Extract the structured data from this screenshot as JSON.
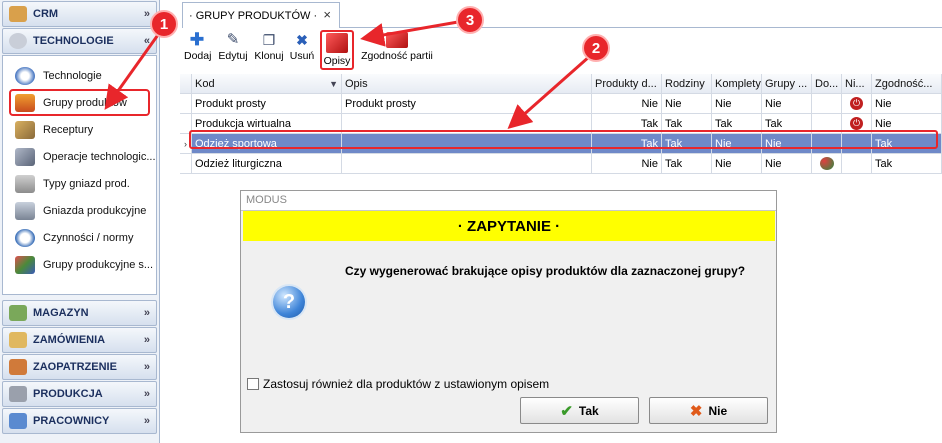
{
  "sidebar": {
    "groups_top": [
      {
        "label": "CRM"
      },
      {
        "label": "TECHNOLOGIE"
      }
    ],
    "items": [
      {
        "label": "Technologie"
      },
      {
        "label": "Grupy produktów"
      },
      {
        "label": "Receptury"
      },
      {
        "label": "Operacje technologic..."
      },
      {
        "label": "Typy gniazd prod."
      },
      {
        "label": "Gniazda produkcyjne"
      },
      {
        "label": "Czynności / normy"
      },
      {
        "label": "Grupy produkcyjne s..."
      }
    ],
    "groups_bottom": [
      {
        "label": "MAGAZYN"
      },
      {
        "label": "ZAMÓWIENIA"
      },
      {
        "label": "ZAOPATRZENIE"
      },
      {
        "label": "PRODUKCJA"
      },
      {
        "label": "PRACOWNICY"
      }
    ]
  },
  "tab": {
    "label": "· GRUPY PRODUKTÓW ·",
    "close": "×"
  },
  "toolbar": {
    "dodaj": "Dodaj",
    "edytuj": "Edytuj",
    "klonuj": "Klonuj",
    "usun": "Usuń",
    "opisy": "Opisy",
    "zgodnosc": "Zgodność partii"
  },
  "grid": {
    "columns": [
      "Kod",
      "Opis",
      "Produkty d...",
      "Rodziny",
      "Komplety",
      "Grupy ...",
      "Do...",
      "Ni...",
      "Zgodność..."
    ],
    "rows": [
      [
        "Produkt prosty",
        "Produkt prosty",
        "Nie",
        "Nie",
        "Nie",
        "Nie",
        "",
        "",
        "Nie"
      ],
      [
        "Produkcja wirtualna",
        "",
        "Tak",
        "Tak",
        "Tak",
        "Tak",
        "",
        "",
        "Nie"
      ],
      [
        "Odzież sportowa",
        "",
        "Tak",
        "Tak",
        "Nie",
        "Nie",
        "",
        "",
        "Tak"
      ],
      [
        "Odzież liturgiczna",
        "",
        "Nie",
        "Tak",
        "Nie",
        "Nie",
        "",
        "",
        "Tak"
      ]
    ]
  },
  "dialog": {
    "title": "MODUS",
    "banner": "· ZAPYTANIE ·",
    "question": "Czy wygenerować brakujące opisy produktów dla zaznaczonej grupy?",
    "checkbox": "Zastosuj również dla produktów z ustawionym opisem",
    "yes": "Tak",
    "no": "Nie"
  },
  "callouts": [
    "1",
    "2",
    "3"
  ],
  "colors": {
    "accent_red": "#e8262b",
    "selection": "#6f89c8",
    "banner": "#ffff00"
  }
}
